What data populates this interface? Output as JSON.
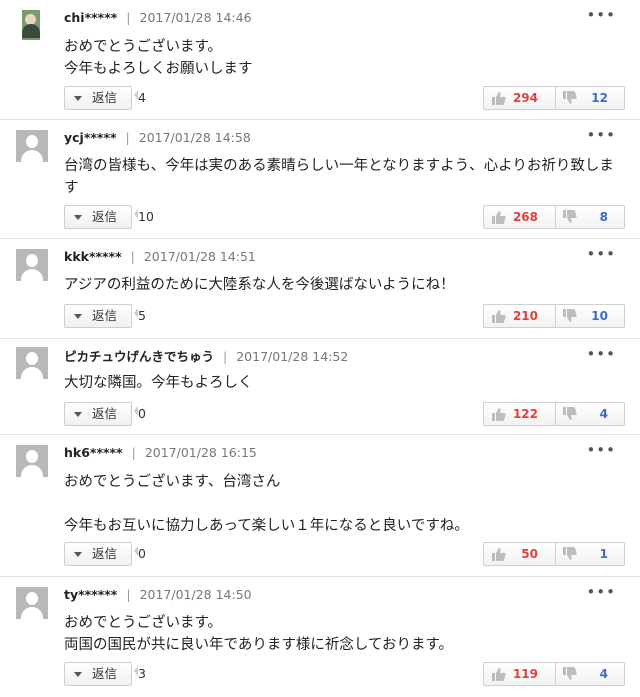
{
  "ui": {
    "reply_label": "返信",
    "more_glyph": "•••",
    "separator": "|"
  },
  "comments": [
    {
      "user": "chi*****",
      "date": "2017/01/28 14:46",
      "text": "おめでとうございます。\n今年もよろしくお願いします",
      "replies": "4",
      "likes": "294",
      "dislikes": "12"
    },
    {
      "user": "ycj*****",
      "date": "2017/01/28 14:58",
      "text": "台湾の皆様も、今年は実のある素晴らしい一年となりますよう、心よりお祈り致します",
      "replies": "10",
      "likes": "268",
      "dislikes": "8"
    },
    {
      "user": "kkk*****",
      "date": "2017/01/28 14:51",
      "text": "アジアの利益のために大陸系な人を今後選ばないようにね！",
      "replies": "5",
      "likes": "210",
      "dislikes": "10"
    },
    {
      "user": "ピカチュウげんきでちゅう",
      "date": "2017/01/28 14:52",
      "text": "大切な隣国。今年もよろしく",
      "replies": "0",
      "likes": "122",
      "dislikes": "4"
    },
    {
      "user": "hk6*****",
      "date": "2017/01/28 16:15",
      "text": "おめでとうございます、台湾さん\n\n今年もお互いに協力しあって楽しい１年になると良いですね。",
      "replies": "0",
      "likes": "50",
      "dislikes": "1"
    },
    {
      "user": "ty******",
      "date": "2017/01/28 14:50",
      "text": "おめでとうございます。\n両国の国民が共に良い年であります様に祈念しております。",
      "replies": "3",
      "likes": "119",
      "dislikes": "4"
    }
  ]
}
